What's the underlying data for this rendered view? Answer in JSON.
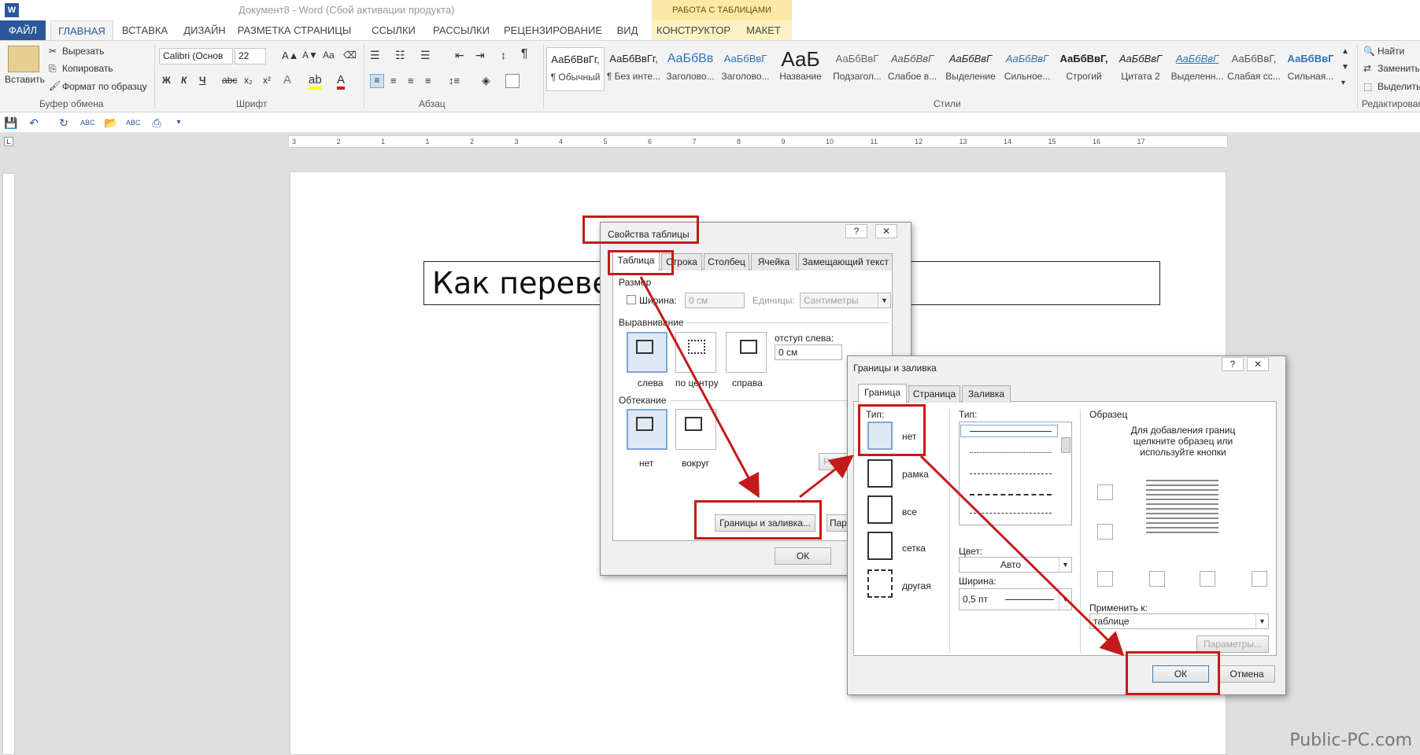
{
  "window": {
    "title": "Документ8 - Word (Сбой активации продукта)",
    "logo": "W"
  },
  "ribbon_tabs": {
    "context_header": "РАБОТА С ТАБЛИЦАМИ",
    "file": "ФАЙЛ",
    "home": "ГЛАВНАЯ",
    "insert": "ВСТАВКА",
    "design": "ДИЗАЙН",
    "layout": "РАЗМЕТКА СТРАНИЦЫ",
    "references": "ССЫЛКИ",
    "mailings": "РАССЫЛКИ",
    "review": "РЕЦЕНЗИРОВАНИЕ",
    "view": "ВИД",
    "constructor": "КОНСТРУКТОР",
    "maket": "МАКЕТ"
  },
  "clipboard": {
    "paste": "Вставить",
    "cut": "Вырезать",
    "copy": "Копировать",
    "format_painter": "Формат по образцу",
    "label": "Буфер обмена"
  },
  "font": {
    "name": "Calibri (Основ",
    "size": "22",
    "bold": "Ж",
    "italic": "К",
    "underline": "Ч",
    "strike": "abc",
    "subscript": "x₂",
    "superscript": "x²",
    "aa": "Aa",
    "label": "Шрифт"
  },
  "paragraph": {
    "pilcrow": "¶",
    "label": "Абзац"
  },
  "styles": {
    "label": "Стили",
    "items": [
      {
        "preview": "АаБбВвГг,",
        "name": "¶ Обычный"
      },
      {
        "preview": "АаБбВвГг,",
        "name": "¶ Без инте..."
      },
      {
        "preview": "АаБбВв",
        "name": "Заголово..."
      },
      {
        "preview": "АаБбВвГ",
        "name": "Заголово..."
      },
      {
        "preview": "АаБ",
        "name": "Название"
      },
      {
        "preview": "АаБбВвГ",
        "name": "Подзагол..."
      },
      {
        "preview": "АаБбВвГ",
        "name": "Слабое в..."
      },
      {
        "preview": "АаБбВвГ",
        "name": "Выделение"
      },
      {
        "preview": "АаБбВвГ",
        "name": "Сильное..."
      },
      {
        "preview": "АаБбВвГ,",
        "name": "Строгий"
      },
      {
        "preview": "АаБбВвГ",
        "name": "Цитата 2"
      },
      {
        "preview": "АаБбВвГ",
        "name": "Выделенн..."
      },
      {
        "preview": "АаБбВвГ,",
        "name": "Слабая сс..."
      },
      {
        "preview": "АаБбВвГ",
        "name": "Сильная..."
      }
    ]
  },
  "editing": {
    "find": "Найти",
    "replace": "Заменить",
    "select": "Выделить",
    "label": "Редактирование"
  },
  "ruler": {
    "ticks": [
      "3",
      "2",
      "1",
      "1",
      "2",
      "3",
      "4",
      "5",
      "6",
      "7",
      "8",
      "9",
      "10",
      "11",
      "12",
      "13",
      "14",
      "15",
      "16",
      "17"
    ]
  },
  "document": {
    "table_text": "Как перевер"
  },
  "table_props": {
    "title": "Свойства таблицы",
    "help": "?",
    "close": "✕",
    "tabs": [
      "Таблица",
      "Строка",
      "Столбец",
      "Ячейка",
      "Замещающий текст"
    ],
    "size_label": "Размер",
    "width_label": "Ширина:",
    "width_value": "0 см",
    "units_label": "Единицы:",
    "units_value": "Сантиметры",
    "alignment_label": "Выравнивание",
    "indent_label": "отступ слева:",
    "indent_value": "0 см",
    "align_left": "слева",
    "align_center": "по центру",
    "align_right": "справа",
    "wrap_label": "Обтекание",
    "wrap_none": "нет",
    "wrap_around": "вокруг",
    "position_btn": "Разм",
    "borders_btn": "Границы и заливка...",
    "params_btn": "Пар",
    "ok": "ОК"
  },
  "borders_dialog": {
    "title": "Границы и заливка",
    "help": "?",
    "close": "✕",
    "tabs": [
      "Граница",
      "Страница",
      "Заливка"
    ],
    "type_label": "Тип:",
    "types": [
      "нет",
      "рамка",
      "все",
      "сетка",
      "другая"
    ],
    "line_type_label": "Тип:",
    "color_label": "Цвет:",
    "color_value": "Авто",
    "width_label": "Ширина:",
    "width_value": "0,5 пт",
    "preview_label": "Образец",
    "preview_hint": "Для добавления границ щелкните образец или используйте кнопки",
    "apply_label": "Применить к:",
    "apply_value": "таблице",
    "params_btn": "Параметры...",
    "ok": "ОК",
    "cancel": "Отмена"
  },
  "watermark": "Public-PC.com",
  "colors": {
    "accent": "#2b579a",
    "highlight": "#c41a1a",
    "context": "#fde9a7"
  }
}
